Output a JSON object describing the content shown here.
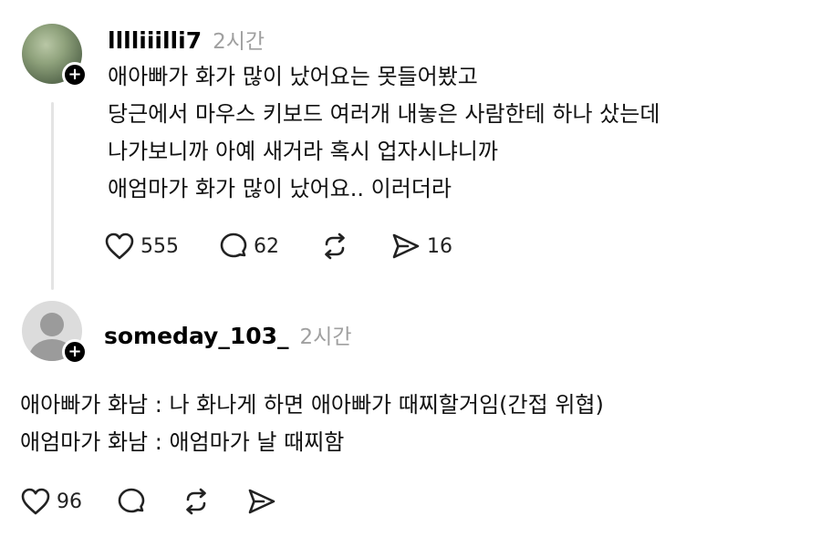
{
  "posts": [
    {
      "username": "lllliiilli7",
      "time": "2시간",
      "avatar": "photo-avatar",
      "lines": [
        "애아빠가 화가 많이 났어요는 못들어봤고",
        "당근에서 마우스 키보드 여러개 내놓은 사람한테 하나 샀는데",
        "나가보니까 아예 새거라 혹시 업자시냐니까",
        "애엄마가 화가 많이 났어요.. 이러더라"
      ],
      "likes": "555",
      "comments": "62",
      "reposts": "",
      "shares": "16"
    },
    {
      "username": "someday_103_",
      "time": "2시간",
      "avatar": "default-avatar",
      "lines": [
        "애아빠가 화남 : 나 화나게 하면 애아빠가 때찌할거임(간접 위협)",
        "애엄마가 화남 : 애엄마가 날 때찌함"
      ],
      "likes": "96",
      "comments": "",
      "reposts": "",
      "shares": ""
    }
  ],
  "icons": {
    "like": "heart-icon",
    "comment": "comment-bubble-icon",
    "repost": "repost-icon",
    "share": "send-icon",
    "follow": "plus-icon"
  },
  "follow_symbol": "+"
}
